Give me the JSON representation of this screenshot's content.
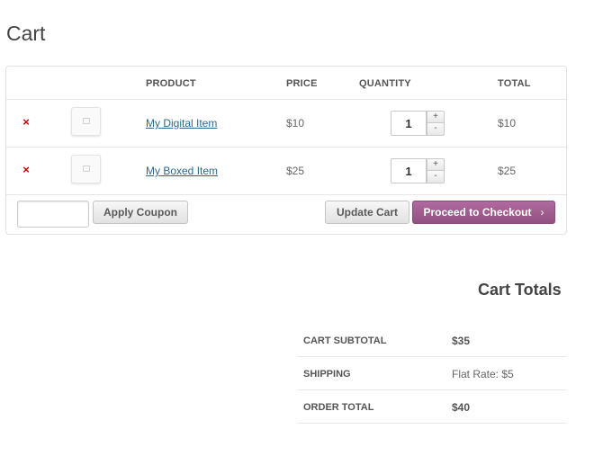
{
  "page": {
    "title": "Cart"
  },
  "cart_table": {
    "headers": {
      "product": "PRODUCT",
      "price": "PRICE",
      "quantity": "QUANTITY",
      "total": "TOTAL"
    },
    "rows": [
      {
        "remove_glyph": "×",
        "thumbnail_icon": "image-placeholder-icon",
        "product": "My Digital Item",
        "price": "$10",
        "quantity": "1",
        "total": "$10"
      },
      {
        "remove_glyph": "×",
        "thumbnail_icon": "image-placeholder-icon",
        "product": "My Boxed Item",
        "price": "$25",
        "quantity": "1",
        "total": "$25"
      }
    ],
    "qty_plus": "+",
    "qty_minus": "-"
  },
  "actions": {
    "coupon_value": "",
    "apply_coupon": "Apply Coupon",
    "update_cart": "Update Cart",
    "checkout": "Proceed to Checkout",
    "checkout_arrow": "›"
  },
  "totals": {
    "title": "Cart Totals",
    "rows": [
      {
        "label": "CART SUBTOTAL",
        "value": "$35"
      },
      {
        "label": "SHIPPING",
        "value": "Flat Rate: $5"
      },
      {
        "label": "ORDER TOTAL",
        "value": "$40"
      }
    ]
  },
  "colors": {
    "accent": "#a05c93",
    "link": "#2b6a8f",
    "remove": "#cc0000"
  }
}
